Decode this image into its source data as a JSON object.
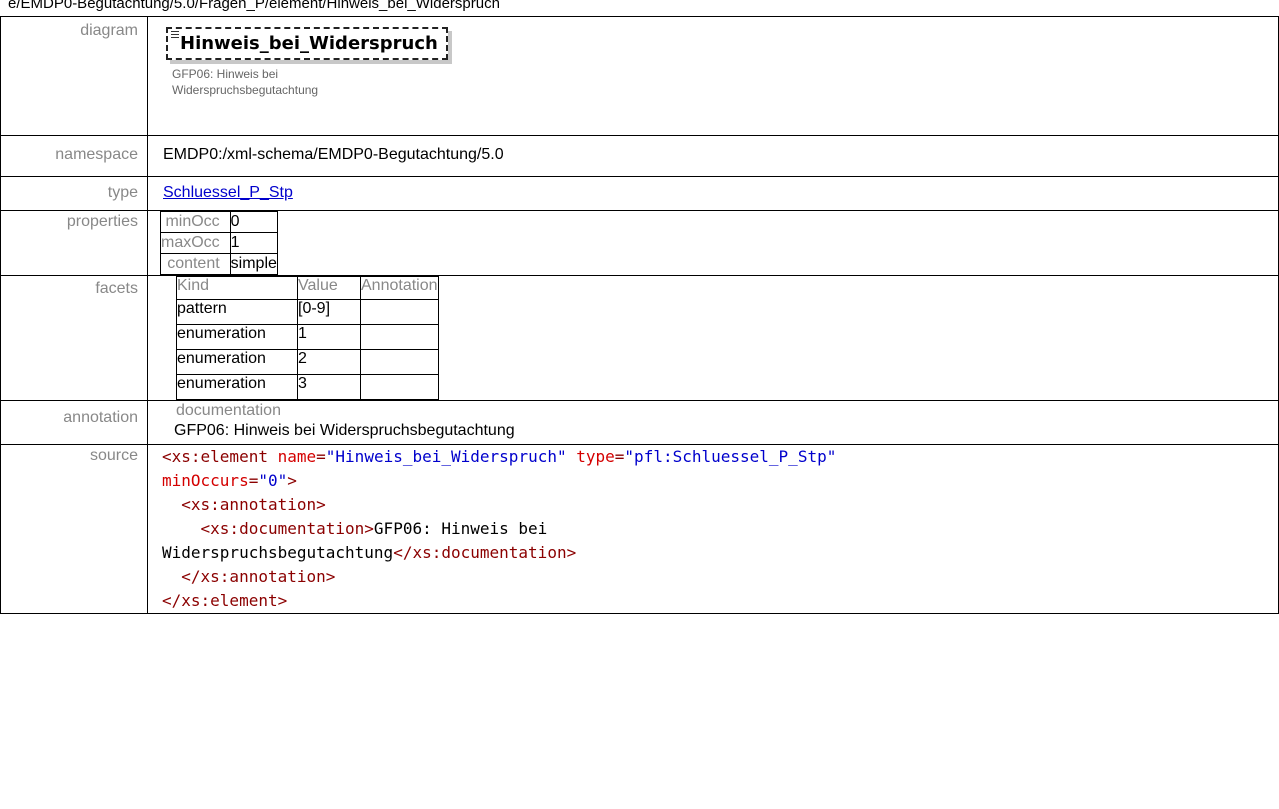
{
  "top_line": "e/EMDP0-Begutachtung/5.0/Fragen_P/element/Hinweis_bei_Widerspruch",
  "rows": {
    "diagram": {
      "label": "diagram",
      "element_name": "Hinweis_bei_Widerspruch",
      "element_doc": "GFP06: Hinweis bei Widerspruchsbegutachtung"
    },
    "namespace": {
      "label": "namespace",
      "value": "EMDP0:/xml-schema/EMDP0-Begutachtung/5.0"
    },
    "type": {
      "label": "type",
      "value": "Schluessel_P_Stp"
    },
    "properties": {
      "label": "properties",
      "items": [
        {
          "key": "minOcc",
          "value": "0"
        },
        {
          "key": "maxOcc",
          "value": "1"
        },
        {
          "key": "content",
          "value": "simple"
        }
      ]
    },
    "facets": {
      "label": "facets",
      "headers": [
        "Kind",
        "Value",
        "Annotation"
      ],
      "items": [
        {
          "kind": "pattern",
          "value": "[0-9]"
        },
        {
          "kind": "enumeration",
          "value": "1"
        },
        {
          "kind": "enumeration",
          "value": "2"
        },
        {
          "kind": "enumeration",
          "value": "3"
        }
      ]
    },
    "annotation": {
      "label": "annotation",
      "heading": "documentation",
      "text": "GFP06: Hinweis bei Widerspruchsbegutachtung"
    },
    "source": {
      "label": "source",
      "line1_tag": "<xs:element",
      "line1_attr1": "name",
      "line1_val1": "\"Hinweis_bei_Widerspruch\"",
      "line1_attr2": "type",
      "line1_val2": "\"pfl:Schluessel_P_Stp\"",
      "line2_attr": "minOccurs",
      "line2_val": "\"0\"",
      "line2_close": ">",
      "line3": "<xs:annotation>",
      "line4_open": "<xs:documentation>",
      "line4_text": "GFP06: Hinweis bei",
      "line5_text": "Widerspruchsbegutachtung",
      "line5_close": "</xs:documentation>",
      "line6": "</xs:annotation>",
      "line7": "</xs:element>"
    }
  }
}
